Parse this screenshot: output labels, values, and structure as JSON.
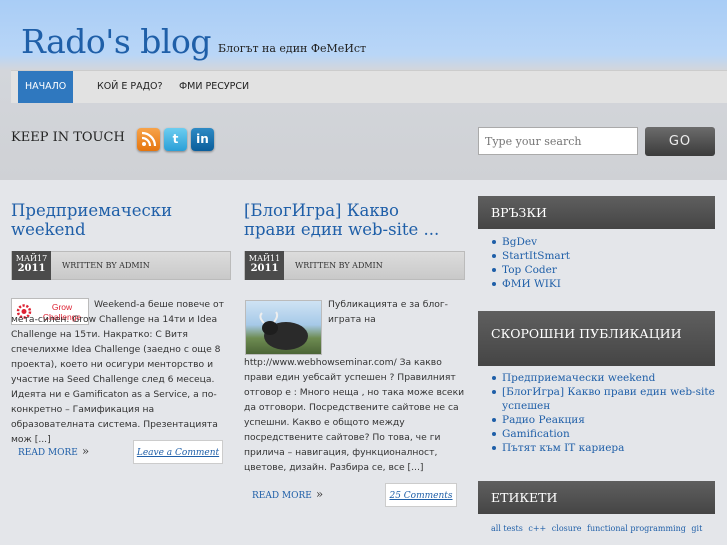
{
  "site": {
    "title": "Rado's blog",
    "tagline": "Блогът на един ФеМеИст"
  },
  "nav": {
    "items": [
      "НАЧАЛО",
      "КОЙ Е РАДО?",
      "ФМИ РЕСУРСИ"
    ],
    "active_index": 0
  },
  "social": {
    "label": "KEEP IN TOUCH",
    "icons": [
      "rss-icon",
      "twitter-icon",
      "linkedin-icon"
    ]
  },
  "search": {
    "placeholder": "Type your search",
    "button": "GO"
  },
  "posts": [
    {
      "title": "Предприемачески weekend",
      "date_month": "МАЙ17",
      "date_year": "2011",
      "written_by": "WRITTEN BY ADMIN",
      "image_text": "Grow Challenge",
      "excerpt": "Weekend-а беше повече от мета-силен. Grow Challenge на 14ти и Idea Challenge на 15ти. Накратко: С Витя спечелихме Idea Challenge (заедно с още 8 проекта), което ни осигури менторство и участие на Seed Challenge след 6 месеца. Идеята ни е Gamificaton as a Service, а по-конкретно – Гамификация на образователната система. Презентацията мож [...]",
      "read_more": "READ MORE",
      "comments": "Leave a Comment"
    },
    {
      "title": "[БлогИгра] Какво прави един web-site ...",
      "date_month": "МАЙ11",
      "date_year": "2011",
      "written_by": "WRITTEN BY ADMIN",
      "excerpt": "Публикацията е за блог-играта на http://www.webhowseminar.com/ За какво прави един уебсайт успешен ? Правилният отговор е : Много неща , но така може всеки да отговори. Посредствените сайтове не са успешни. Какво е общото между посредствените сайтове? По това, че ги прилича – навигация, функционалност, цветове, дизайн. Разбира се, все [...]",
      "read_more": "READ MORE",
      "comments": "25 Comments"
    }
  ],
  "sidebar": {
    "links_title": "ВРЪЗКИ",
    "links": [
      "BgDev",
      "StartItSmart",
      "Top Coder",
      "ФМИ WIKI"
    ],
    "recent_title": "СКОРОШНИ ПУБЛИКАЦИИ",
    "recent": [
      "Предприемачески weekend",
      "[БлогИгра] Какво прави един web-site успешен",
      "Радио Реакция",
      "Gamification",
      "Пътят към IT кариера"
    ],
    "tags_title": "ЕТИКЕТИ",
    "tags": [
      "all tests",
      "c++",
      "closure",
      "functional programming",
      "git"
    ]
  }
}
